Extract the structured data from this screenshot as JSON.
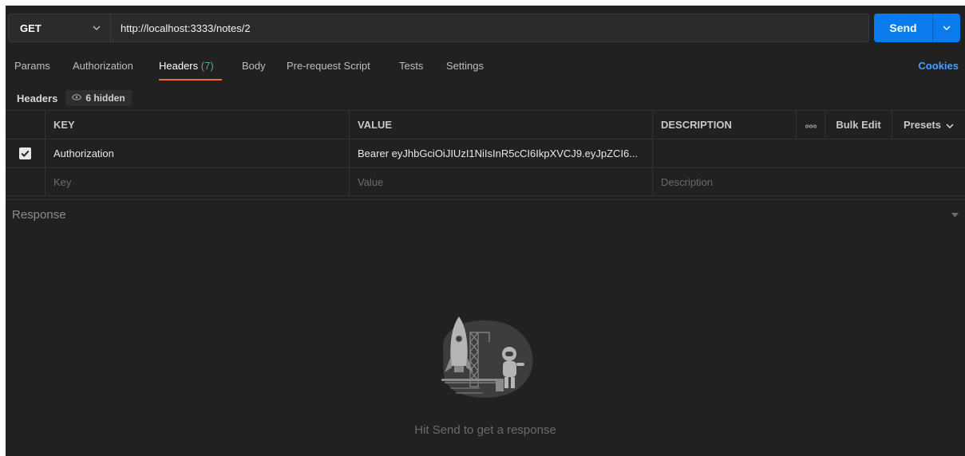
{
  "request": {
    "method": "GET",
    "url": "http://localhost:3333/notes/2",
    "send_label": "Send"
  },
  "tabs": [
    {
      "label": "Params"
    },
    {
      "label": "Authorization"
    },
    {
      "label": "Headers",
      "count": "(7)"
    },
    {
      "label": "Body"
    },
    {
      "label": "Pre-request Script"
    },
    {
      "label": "Tests"
    },
    {
      "label": "Settings"
    }
  ],
  "active_tab": "Headers",
  "cookies_label": "Cookies",
  "headers_section": {
    "label": "Headers",
    "hidden_label": "6 hidden"
  },
  "table": {
    "columns": {
      "key": "KEY",
      "value": "VALUE",
      "description": "DESCRIPTION",
      "more": "ooo",
      "bulk_edit": "Bulk Edit",
      "presets": "Presets"
    },
    "rows": [
      {
        "checked": true,
        "key": "Authorization",
        "value": "Bearer eyJhbGciOiJIUzI1NiIsInR5cCI6IkpXVCJ9.eyJpZCI6...",
        "description": ""
      }
    ],
    "placeholders": {
      "key": "Key",
      "value": "Value",
      "description": "Description"
    }
  },
  "response": {
    "title": "Response",
    "hint": "Hit Send to get a response"
  },
  "colors": {
    "accent": "#097bed",
    "tab_underline": "#f26b3a",
    "count_green": "#4fb47a",
    "cookies_link": "#4a9fff",
    "background": "#212121"
  }
}
